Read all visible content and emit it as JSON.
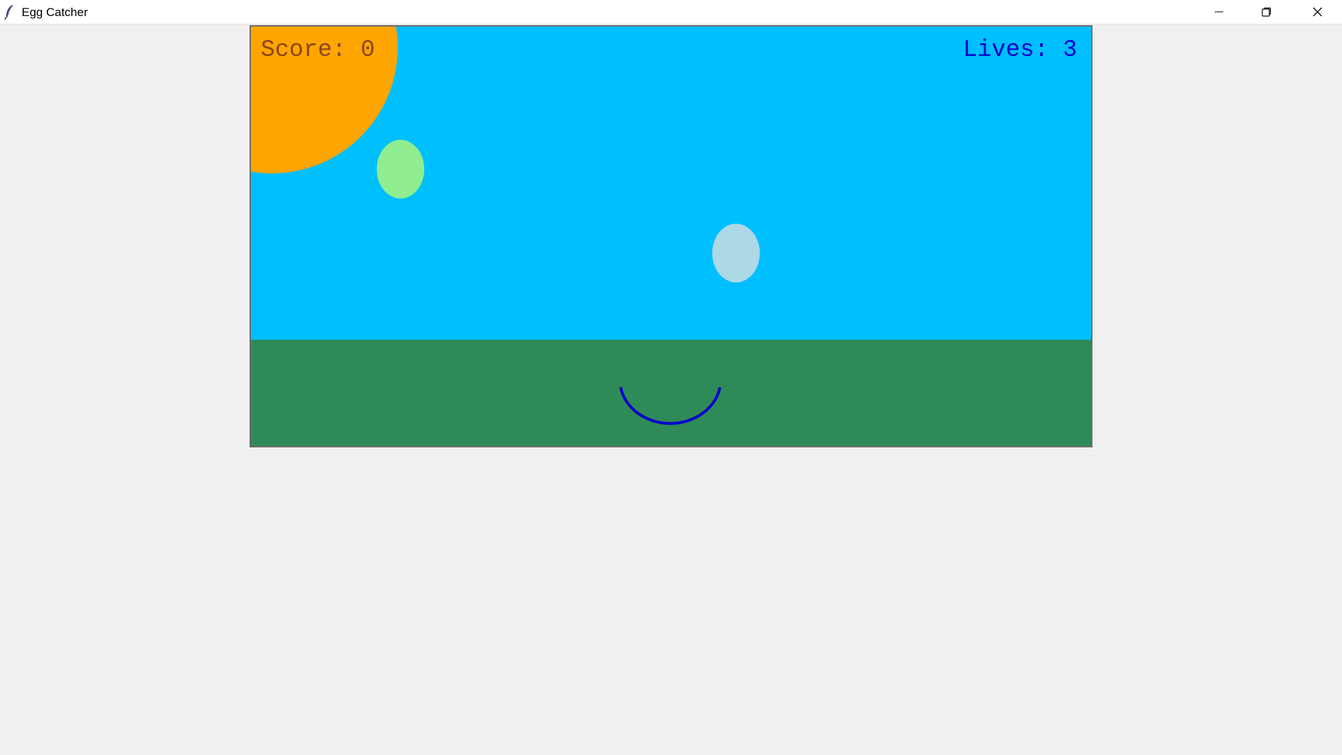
{
  "window": {
    "title": "Egg Catcher",
    "app_icon": "feather-icon",
    "controls": {
      "minimize_icon": "minimize-icon",
      "maximize_icon": "restore-icon",
      "close_icon": "close-icon"
    }
  },
  "game": {
    "score_label": "Score: 0",
    "lives_label": "Lives: 3",
    "colors": {
      "sky": "#00bfff",
      "grass": "#2e8b57",
      "sun": "#ffa500",
      "egg_green": "#90ee90",
      "egg_blue": "#add8e6",
      "catcher": "#0000cd",
      "score_text": "#8b4513",
      "lives_text": "#0000cd"
    },
    "eggs": [
      {
        "name": "egg-green",
        "color": "#90ee90"
      },
      {
        "name": "egg-lightblue",
        "color": "#add8e6"
      }
    ]
  }
}
